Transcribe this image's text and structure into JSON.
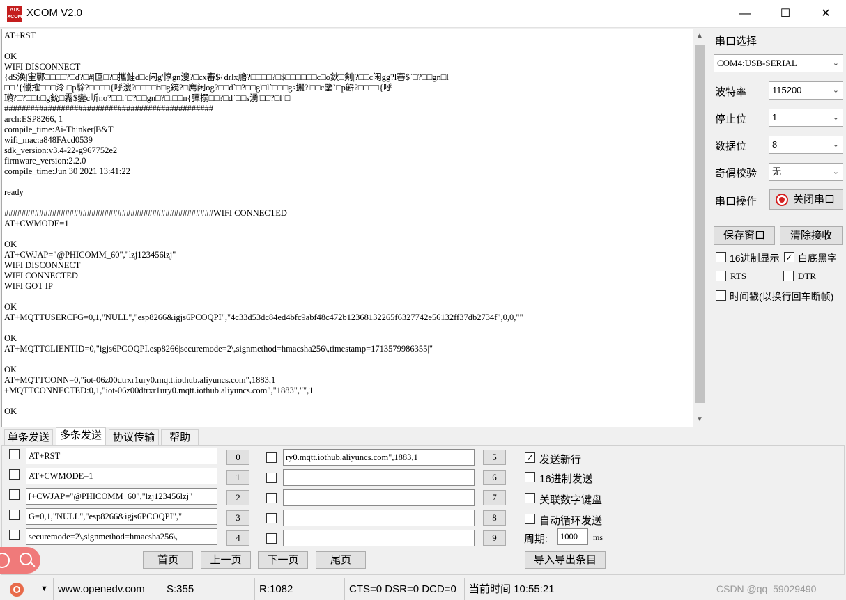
{
  "window": {
    "logo_text": "ATK XCOM",
    "title": "XCOM V2.0",
    "minimize": "—",
    "maximize": "☐",
    "close": "✕"
  },
  "receive": {
    "text": "AT+RST\n\nOK\nWIFI DISCONNECT\n{d$涣|宔鄲□□□□?□d?□#|叵□?□攜鮭d□c闲g'惇gn溲?□cx審${drlx艪?□□□□?□$□□□□□□c□o鈥□剣|?□□c闲gg?l審$`□?□□gn□l\n□□ '{儠搉□□□泠 □p駼?□□□□{呼溲?□□□□b□g銃?□廌闲og?□□d`□?□□g'□l`□□□gs攦?'□□c鑒`□p簖?□□□□{呼\n瓎?□?□□b□g銃□霿$鑾c岓no?□□l`□?□□gn□?□l□□n{彈搦□□?□d`□□s湧'□□?□l`□\n################################################\narch:ESP8266, 1\ncompile_time:Ai-Thinker|B&T\nwifi_mac:a848FAcd0539\nsdk_version:v3.4-22-g967752e2\nfirmware_version:2.2.0\ncompile_time:Jun 30 2021 13:41:22\n\nready\n\n################################################WIFI CONNECTED\nAT+CWMODE=1\n\nOK\nAT+CWJAP=\"@PHICOMM_60\",\"lzj123456lzj\"\nWIFI DISCONNECT\nWIFI CONNECTED\nWIFI GOT IP\n\nOK\nAT+MQTTUSERCFG=0,1,\"NULL\",\"esp8266&igjs6PCOQPI\",\"4c33d53dc84ed4bfc9abf48c472b12368132265f6327742e56132ff37db2734f\",0,0,\"\"\n\nOK\nAT+MQTTCLIENTID=0,\"igjs6PCOQPI.esp8266|securemode=2\\,signmethod=hmacsha256\\,timestamp=1713579986355|\"\n\nOK\nAT+MQTTCONN=0,\"iot-06z00dtrxr1ury0.mqtt.iothub.aliyuncs.com\",1883,1\n+MQTTCONNECTED:0,1,\"iot-06z00dtrxr1ury0.mqtt.iothub.aliyuncs.com\",\"1883\",\"\",1\n\nOK"
  },
  "settings": {
    "port_label": "串口选择",
    "port_value": "COM4:USB-SERIAL",
    "baud_label": "波特率",
    "baud_value": "115200",
    "stop_label": "停止位",
    "stop_value": "1",
    "data_label": "数据位",
    "data_value": "8",
    "parity_label": "奇偶校验",
    "parity_value": "无",
    "op_label": "串口操作",
    "op_button": "关闭串口",
    "save_button": "保存窗口",
    "clear_button": "清除接收",
    "hex_display": "16进制显示",
    "white_black": "白底黑字",
    "rts": "RTS",
    "dtr": "DTR",
    "timestamp": "时间戳(以换行回车断帧)"
  },
  "tabs": [
    "单条发送",
    "多条发送",
    "协议传输",
    "帮助"
  ],
  "multi_send": {
    "left_inputs": [
      "AT+RST",
      "AT+CWMODE=1",
      "[+CWJAP=\"@PHICOMM_60\",\"lzj123456lzj\"",
      "G=0,1,\"NULL\",\"esp8266&igjs6PCOQPI\",\"",
      "securemode=2\\,signmethod=hmacsha256\\,"
    ],
    "left_numbers": [
      "0",
      "1",
      "2",
      "3",
      "4"
    ],
    "right_inputs": [
      "ry0.mqtt.iothub.aliyuncs.com\",1883,1",
      "",
      "",
      "",
      ""
    ],
    "right_numbers": [
      "5",
      "6",
      "7",
      "8",
      "9"
    ],
    "options": {
      "send_newline": "发送新行",
      "hex_send": "16进制发送",
      "numeric_keypad": "关联数字键盘",
      "auto_loop": "自动循环发送",
      "period_label": "周期:",
      "period_value": "1000",
      "period_unit": "ms"
    },
    "pages": {
      "home": "首页",
      "prev": "上一页",
      "next": "下一页",
      "last": "尾页",
      "import_export": "导入导出条目"
    }
  },
  "statusbar": {
    "url": "www.openedv.com",
    "sent": "S:355",
    "received": "R:1082",
    "lines": "CTS=0 DSR=0 DCD=0",
    "time": "当前时间 10:55:21",
    "watermark": "CSDN @qq_59029490"
  },
  "colors": {
    "accent_red": "#d42020",
    "window_bg": "#f0f0f0"
  }
}
